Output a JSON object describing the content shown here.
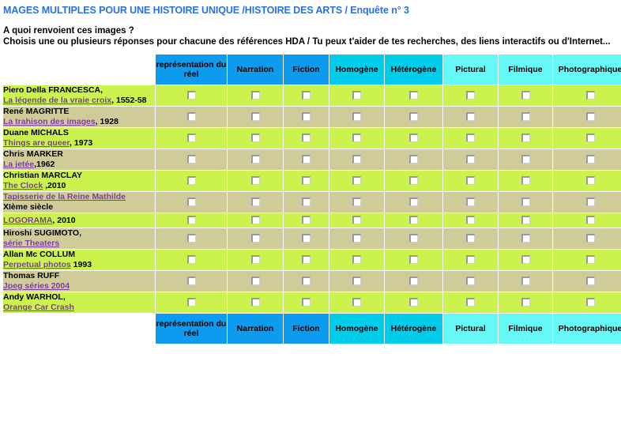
{
  "header": {
    "title": "MAGES MULTIPLES POUR UNE HISTOIRE UNIQUE /HISTOIRE DES ARTS / Enquête n° 3",
    "question": "A quoi renvoient ces images ?",
    "directive": "Choisis une ou plusieurs réponses pour chacune des références HDA / Tu peux t'aider de tes recherches, des liens interactifs ou d'Internet..."
  },
  "colors": {
    "title_blue": "#2970e6",
    "header_tone_a": "#0d9bf0",
    "header_tone_b": "#00cdeb",
    "header_tone_c": "#66f7f7",
    "row_green": "#ccf24d",
    "row_khaki": "#d0cc9a",
    "link_purple": "#7b3fa0"
  },
  "table": {
    "corner_label": "",
    "columns": [
      {
        "label": "représentation du réel",
        "tone": "tone-a",
        "width": "c-1"
      },
      {
        "label": "Narration",
        "tone": "tone-a",
        "width": "c-2"
      },
      {
        "label": "Fiction",
        "tone": "tone-a",
        "width": "c-3"
      },
      {
        "label": "Homogène",
        "tone": "tone-b",
        "width": "c-4"
      },
      {
        "label": "Hétérogène",
        "tone": "tone-b",
        "width": "c-5"
      },
      {
        "label": "Pictural",
        "tone": "tone-c",
        "width": "c-6"
      },
      {
        "label": "Filmique",
        "tone": "tone-c",
        "width": "c-7"
      },
      {
        "label": "Photographique",
        "tone": "tone-c",
        "width": "c-8"
      }
    ],
    "rows": [
      {
        "shade": "row-a",
        "line1_pre": "Piero Della FRANCESCA,",
        "line2_link": "La légende de la vraie croix",
        "line2_post": ", 1552-58"
      },
      {
        "shade": "row-b",
        "line1_pre": "René MAGRITTE",
        "line2_link": "La trahison des images",
        "line2_post": ", 1928"
      },
      {
        "shade": "row-a",
        "line1_pre": "Duane MICHALS",
        "line2_link": "Things are queer",
        "line2_post": ", 1973"
      },
      {
        "shade": "row-b",
        "line1_pre": "Chris MARKER",
        "line2_link": "La jetée",
        "line2_post": ",1962"
      },
      {
        "shade": "row-a",
        "line1_pre": "Christian MARCLAY",
        "line2_link": "The Clock",
        "line2_post": " ,2010"
      },
      {
        "shade": "row-b",
        "line1_link": "Tapisserie de la Reine Mathilde",
        "line2_pre": "XIème siècle"
      },
      {
        "shade": "row-a",
        "line1_link": "LOGORAMA",
        "line1_post": ", 2010"
      },
      {
        "shade": "row-b",
        "line1_pre": "Hiroshi SUGIMOTO,",
        "line2_link": "série Theaters"
      },
      {
        "shade": "row-a",
        "line1_pre": "Allan Mc COLLUM",
        "line2_link": "Perpetual photos",
        "line2_post": " 1993"
      },
      {
        "shade": "row-b",
        "line1_pre": "Thomas RUFF",
        "line2_link": "Jpeg séries 2004"
      },
      {
        "shade": "row-a",
        "line1_pre": "Andy WARHOL,",
        "line2_link": "Orange Car Crash"
      }
    ]
  }
}
